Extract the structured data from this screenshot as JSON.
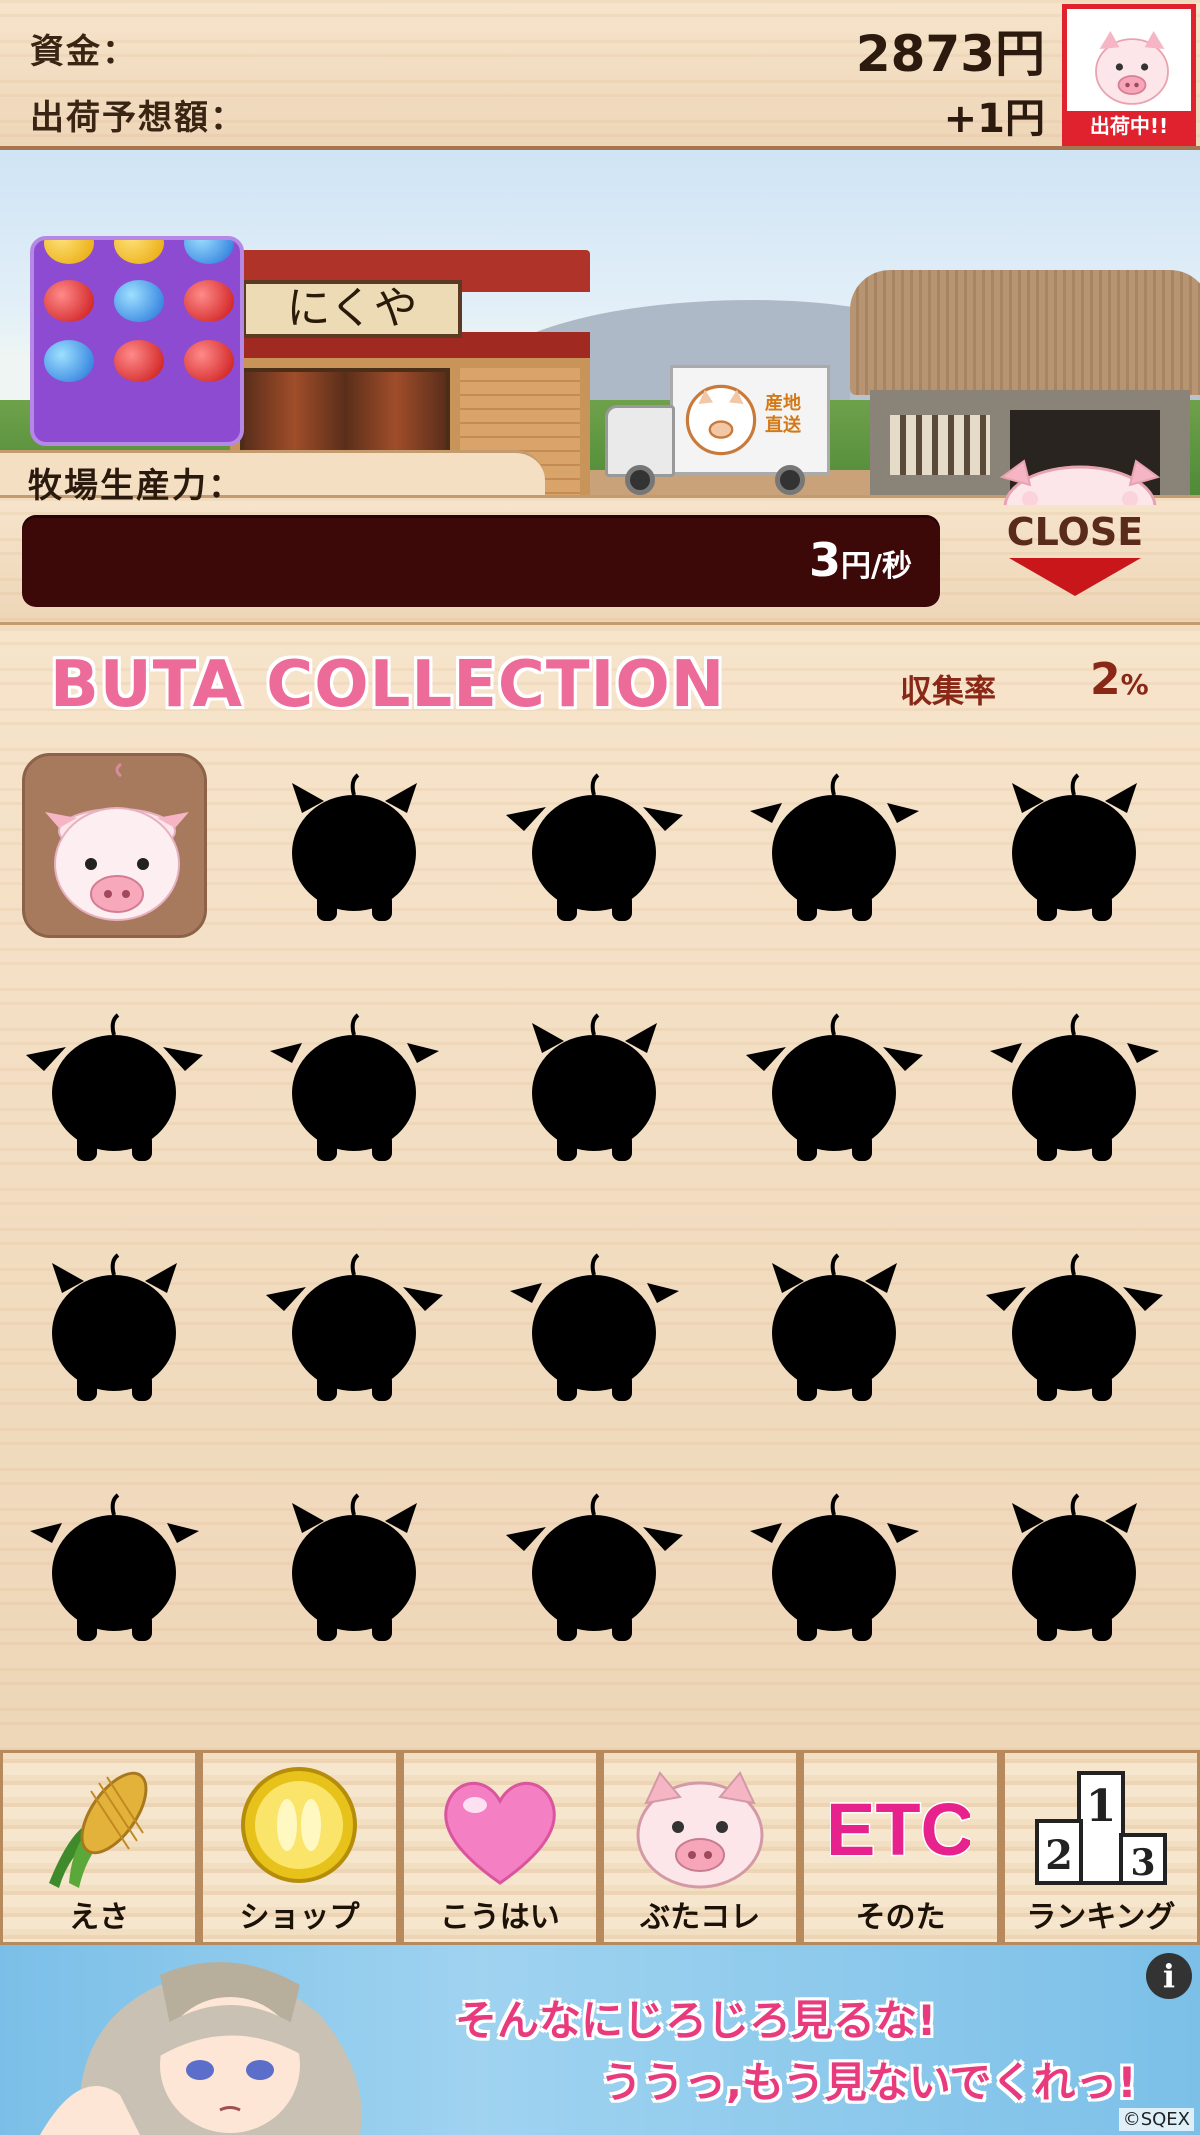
{
  "header": {
    "funds_label": "資金：",
    "funds_value": "2873円",
    "forecast_label": "出荷予想額：",
    "forecast_value": "+1円",
    "ship_status": "出荷中!!"
  },
  "farm": {
    "shop_sign": "にくや",
    "truck_text_1": "産地",
    "truck_text_2": "直送"
  },
  "production": {
    "label": "牧場生産力：",
    "value": "3",
    "unit": "円/秒"
  },
  "close_button": {
    "label": "CLOSE"
  },
  "collection": {
    "title": "BUTA COLLECTION",
    "rate_label": "収集率",
    "rate_value": "2",
    "rate_unit": "%",
    "slots": [
      {
        "state": "unlocked"
      },
      {
        "state": "locked"
      },
      {
        "state": "locked"
      },
      {
        "state": "locked"
      },
      {
        "state": "locked"
      },
      {
        "state": "locked"
      },
      {
        "state": "locked"
      },
      {
        "state": "locked"
      },
      {
        "state": "locked"
      },
      {
        "state": "locked"
      },
      {
        "state": "locked"
      },
      {
        "state": "locked"
      },
      {
        "state": "locked"
      },
      {
        "state": "locked"
      },
      {
        "state": "locked"
      },
      {
        "state": "locked"
      },
      {
        "state": "locked"
      },
      {
        "state": "locked"
      },
      {
        "state": "locked"
      },
      {
        "state": "locked"
      }
    ]
  },
  "nav": [
    {
      "label": "えさ",
      "icon": "corn-icon"
    },
    {
      "label": "ショップ",
      "icon": "coin-icon"
    },
    {
      "label": "こうはい",
      "icon": "heart-icon"
    },
    {
      "label": "ぶたコレ",
      "icon": "pig-icon"
    },
    {
      "label": "そのた",
      "icon": "etc-icon",
      "icon_text": "ETC"
    },
    {
      "label": "ランキング",
      "icon": "podium-icon",
      "icon_text_1": "1",
      "icon_text_2": "2",
      "icon_text_3": "3"
    }
  ],
  "ad": {
    "line1": "そんなにじろじろ見るな!",
    "line2": "ううっ,もう見ないでくれっ!",
    "info": "i",
    "copyright": "©SQEX"
  },
  "colors": {
    "accent_pink": "#ec6b98",
    "status_red": "#e0222e",
    "bar_dark": "#3d0808"
  }
}
